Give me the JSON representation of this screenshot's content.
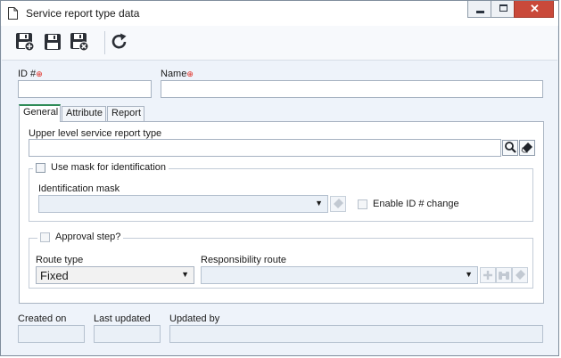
{
  "window": {
    "title": "Service report type data",
    "controls": [
      "minimize",
      "maximize",
      "close"
    ]
  },
  "toolbar": {
    "buttons": [
      {
        "name": "save-and-new",
        "icon": "floppy-plus-icon"
      },
      {
        "name": "save",
        "icon": "floppy-icon"
      },
      {
        "name": "save-and-exit",
        "icon": "floppy-x-icon"
      },
      {
        "name": "refresh",
        "icon": "refresh-icon"
      }
    ]
  },
  "fields": {
    "id_label": "ID #",
    "id_value": "",
    "name_label": "Name",
    "name_value": "",
    "required_marker": "⊕"
  },
  "tabs": [
    {
      "label": "General",
      "active": true
    },
    {
      "label": "Attribute",
      "active": false
    },
    {
      "label": "Report",
      "active": false
    }
  ],
  "general": {
    "upper_level_label": "Upper level service report type",
    "upper_level_value": "",
    "use_mask_label": "Use mask for identification",
    "use_mask_checked": false,
    "identification_mask_label": "Identification mask",
    "identification_mask_value": "",
    "enable_id_change_label": "Enable ID # change",
    "enable_id_change_checked": false,
    "approval_step_label": "Approval step?",
    "approval_step_checked": false,
    "route_type_label": "Route type",
    "route_type_value": "Fixed",
    "responsibility_route_label": "Responsibility route",
    "responsibility_route_value": ""
  },
  "footer": {
    "created_on_label": "Created on",
    "created_on_value": "",
    "last_updated_label": "Last updated",
    "last_updated_value": "",
    "updated_by_label": "Updated by",
    "updated_by_value": ""
  },
  "colors": {
    "required": "#e0251b",
    "active_tab_accent": "#2e8b57",
    "window_background": "#eef3fa",
    "close_button": "#c9493a"
  }
}
